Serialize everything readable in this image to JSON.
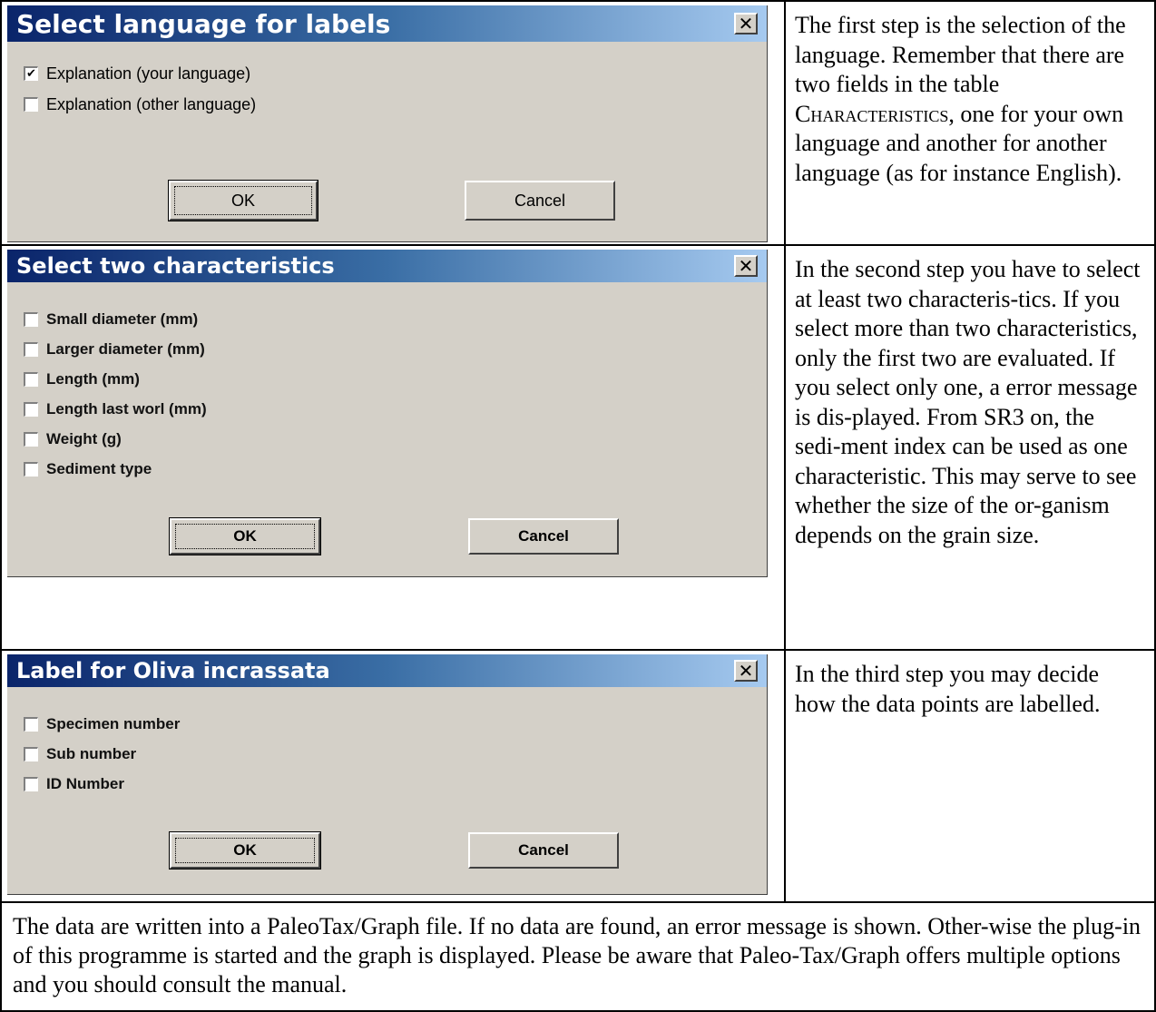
{
  "rows": [
    {
      "dialog": {
        "title": "Select language for labels",
        "close_glyph": "✕",
        "checkboxes": [
          {
            "label": "Explanation (your language)",
            "checked": true
          },
          {
            "label": "Explanation (other language)",
            "checked": false
          }
        ],
        "ok_label": "OK",
        "cancel_label": "Cancel"
      },
      "explanation": {
        "part1": "The first step is the selection of the language. Remember that there are two fields in the table ",
        "smallcaps": "Characteristics",
        "part2": ", one for your own language and another for another language (as for instance English)."
      }
    },
    {
      "dialog": {
        "title": "Select two characteristics",
        "close_glyph": "✕",
        "checkboxes": [
          {
            "label": "Small diameter (mm)",
            "checked": false
          },
          {
            "label": "Larger diameter (mm)",
            "checked": false
          },
          {
            "label": "Length (mm)",
            "checked": false
          },
          {
            "label": "Length last worl (mm)",
            "checked": false
          },
          {
            "label": "Weight (g)",
            "checked": false
          },
          {
            "label": "Sediment type",
            "checked": false
          }
        ],
        "ok_label": "OK",
        "cancel_label": "Cancel"
      },
      "explanation": "In the second step you have to select at least two characteris-tics. If you select more than two characteristics, only the first two are evaluated. If you select only one, a error message is dis-played. From SR3 on, the sedi-ment index can be used as one characteristic. This may serve to see whether the size of the or-ganism depends on the grain size."
    },
    {
      "dialog": {
        "title": "Label for Oliva incrassata",
        "close_glyph": "✕",
        "checkboxes": [
          {
            "label": "Specimen number",
            "checked": false
          },
          {
            "label": "Sub number",
            "checked": false
          },
          {
            "label": "ID Number",
            "checked": false
          }
        ],
        "ok_label": "OK",
        "cancel_label": "Cancel"
      },
      "explanation": "In the third step you may decide how the data points are labelled."
    }
  ],
  "bottom_text": "The data are written into a PaleoTax/Graph file. If no data are found, an error message is shown. Other-wise the plug-in of this programme is started and the graph is displayed. Please be aware that Paleo-Tax/Graph offers multiple options and you should consult the manual."
}
